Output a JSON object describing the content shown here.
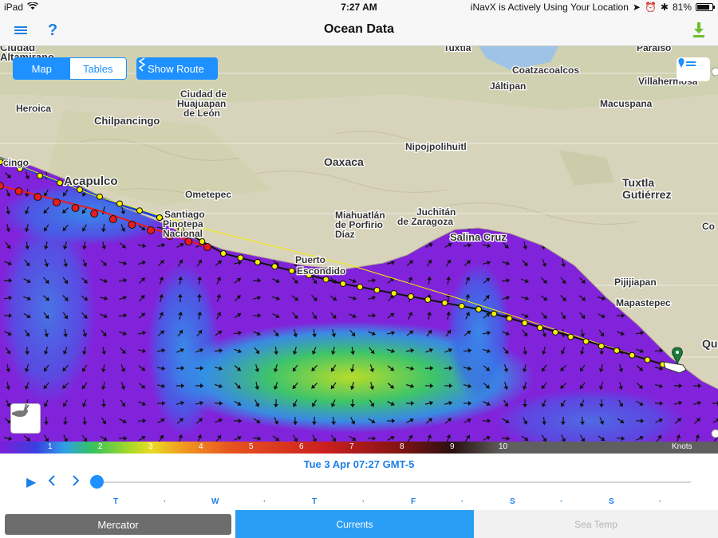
{
  "status_bar": {
    "device": "iPad",
    "time": "7:27 AM",
    "location_text": "iNavX is Actively Using Your Location",
    "battery": "81%",
    "battery_level": 0.81
  },
  "nav": {
    "title": "Ocean Data",
    "help_label": "?"
  },
  "map": {
    "segmented": {
      "map_label": "Map",
      "tables_label": "Tables",
      "selected": "Map"
    },
    "show_route_label": "Show Route",
    "place_labels": [
      "Ciudad",
      "Altamirano",
      "Ciudad de",
      "Huajuapan",
      "de León",
      "Chilpancingo",
      "Acapulco",
      "Ometepec",
      "Santiago",
      "Pinotepa",
      "Nacional",
      "Oaxaca",
      "Nipojpolihuitl",
      "Miahuatlán",
      "de Porfirio",
      "Díaz",
      "Juchitán",
      "de Zaragoza",
      "Salina Cruz",
      "Puerto",
      "Escondido",
      "Tuxtla",
      "Gutiérrez",
      "Pijijiapan",
      "Mapastepec",
      "Tuxtla",
      "Coatzacoalcos",
      "Jáltipan",
      "Paraíso",
      "Villahermosa",
      "Macuspana",
      "Heroica",
      "Co",
      "Qu",
      "cingo"
    ],
    "colors": {
      "current_slow": "#7a1fd8",
      "current_medium": "#2fa0e6",
      "current_fast": "#a6d82a",
      "route_yellow": "#f5f000",
      "route_red": "#e81c1c",
      "route_blue": "#1b3fd6"
    }
  },
  "scale": {
    "ticks": [
      "1",
      "2",
      "3",
      "4",
      "5",
      "6",
      "7",
      "8",
      "9",
      "10"
    ],
    "unit": "Knots"
  },
  "timeline": {
    "time_label": "Tue 3 Apr 07:27 GMT-5",
    "days": [
      "T",
      "·",
      "W",
      "·",
      "T",
      "·",
      "F",
      "·",
      "S",
      "·",
      "S",
      "·"
    ],
    "position": 0.0
  },
  "tabs": {
    "mercator": "Mercator",
    "currents": "Currents",
    "sea_temp": "Sea Temp",
    "active": "Currents"
  }
}
